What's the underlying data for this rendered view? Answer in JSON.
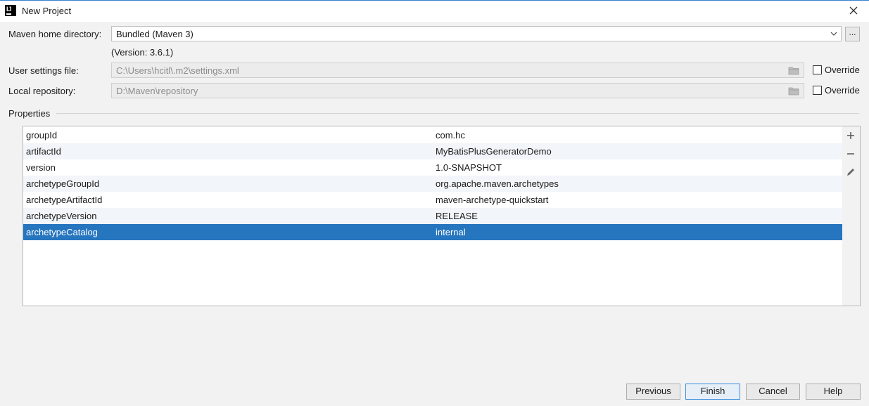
{
  "window": {
    "title": "New Project",
    "app_icon_letters": "IJ"
  },
  "maven_home": {
    "label": "Maven home directory:",
    "value": "Bundled (Maven 3)",
    "browse_label": "...",
    "version_text": "(Version: 3.6.1)"
  },
  "user_settings": {
    "label": "User settings file:",
    "value": "C:\\Users\\hcitl\\.m2\\settings.xml",
    "override_label": "Override"
  },
  "local_repo": {
    "label": "Local repository:",
    "value": "D:\\Maven\\repository",
    "override_label": "Override"
  },
  "properties": {
    "title": "Properties",
    "rows": [
      {
        "key": "groupId",
        "value": "com.hc"
      },
      {
        "key": "artifactId",
        "value": "MyBatisPlusGeneratorDemo"
      },
      {
        "key": "version",
        "value": "1.0-SNAPSHOT"
      },
      {
        "key": "archetypeGroupId",
        "value": "org.apache.maven.archetypes"
      },
      {
        "key": "archetypeArtifactId",
        "value": "maven-archetype-quickstart"
      },
      {
        "key": "archetypeVersion",
        "value": "RELEASE"
      },
      {
        "key": "archetypeCatalog",
        "value": "internal"
      }
    ],
    "selected_index": 6
  },
  "buttons": {
    "previous": "Previous",
    "finish": "Finish",
    "cancel": "Cancel",
    "help": "Help"
  },
  "colors": {
    "selection": "#2675bf",
    "focus_border": "#3d8ee0"
  }
}
